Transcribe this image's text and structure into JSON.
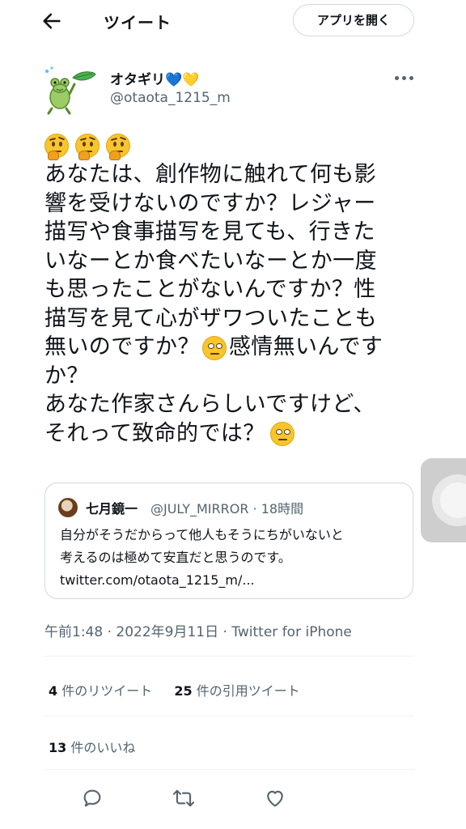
{
  "header": {
    "title": "ツイート",
    "open_app_label": "アプリを開く"
  },
  "tweet": {
    "author_name": "オタギリ",
    "author_hearts": "💙💛",
    "author_handle": "@otaota_1215_m",
    "text_lines": [
      "あなたは、創作物に触れて何も影",
      "響を受けないのですか？レジャー",
      "描写や食事描写を見ても、行きた",
      "いなーとか食べたいなーとか一度",
      "も思ったことがないんですか？性",
      "描写を見て心がザワついたことも",
      "無いのですか？",
      "感情無いんです",
      "か？",
      "あなた作家さんらしいですけど、",
      "それって致命的では？"
    ],
    "timestamp": "午前1:48 · 2022年9月11日 · Twitter for iPhone"
  },
  "quote": {
    "author_name": "七月鏡一",
    "meta": "@JULY_MIRROR · 18時間",
    "text_lines": [
      "自分がそうだからって他人もそうにちがいないと",
      "考えるのは極めて安直だと思うのです。",
      "twitter.com/otaota_1215_m/..."
    ]
  },
  "stats": {
    "retweets_count": "4",
    "retweets_label": "件のリツイート",
    "quotes_count": "25",
    "quotes_label": "件の引用ツイート",
    "likes_count": "13",
    "likes_label": "件のいいね"
  },
  "icons": {
    "back": "arrow-left-icon",
    "more": "more-horizontal-icon",
    "reply": "reply-icon",
    "retweet": "retweet-icon",
    "like": "heart-icon"
  },
  "colors": {
    "text_primary": "#0f1419",
    "text_secondary": "#536471",
    "border": "#cfd9de"
  }
}
